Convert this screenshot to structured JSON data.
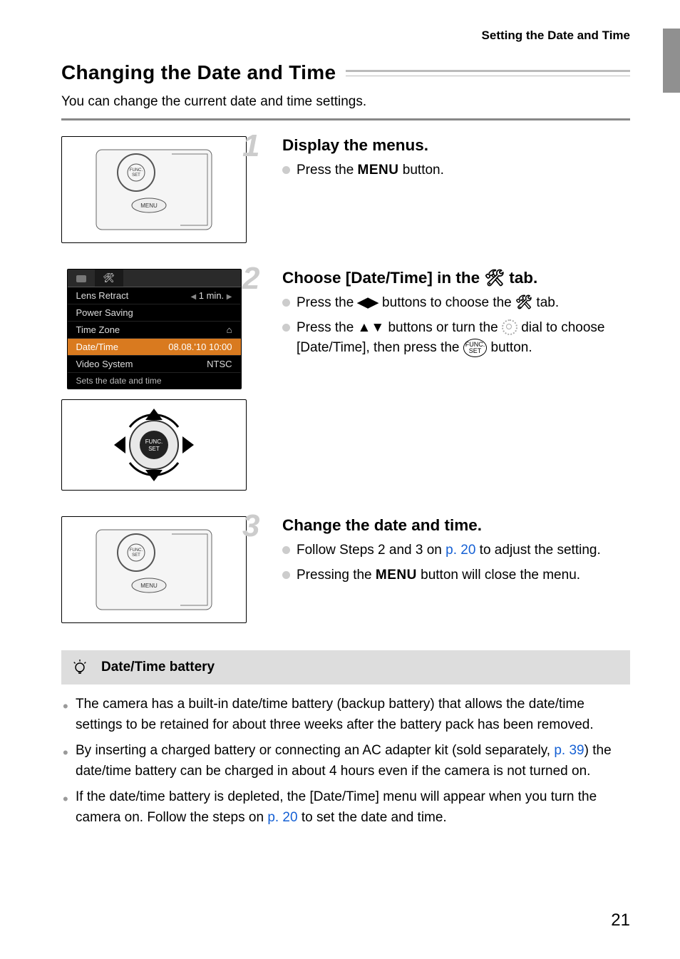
{
  "running_head": "Setting the Date and Time",
  "h1": "Changing the Date and Time",
  "lead": "You can change the current date and time settings.",
  "glyphs": {
    "menu": "MENU",
    "wrench": "🛠",
    "left_right": "◀▶",
    "up_down": "▲▼",
    "func_top": "FUNC.",
    "func_bot": "SET"
  },
  "steps": [
    {
      "num": "1",
      "title": "Display the menus.",
      "lines": {
        "a_pre": "Press the ",
        "a_post": " button."
      }
    },
    {
      "num": "2",
      "title_pre": "Choose [Date/Time] in the ",
      "title_post": " tab.",
      "lines": {
        "a_pre": "Press the ",
        "a_mid": " buttons to choose the ",
        "a_post": " tab.",
        "b_pre": "Press the ",
        "b_mid1": " buttons or turn the ",
        "b_mid2": " dial to choose [Date/Time], then press the ",
        "b_post": " button."
      },
      "menu": {
        "tab_wrench": "🛠",
        "rows": [
          {
            "label": "Lens Retract",
            "value": "1 min."
          },
          {
            "label": "Power Saving",
            "value": ""
          },
          {
            "label": "Time Zone",
            "value": "⌂"
          },
          {
            "label": "Date/Time",
            "value": "08.08.'10 10:00"
          },
          {
            "label": "Video System",
            "value": "NTSC"
          }
        ],
        "footer": "Sets the date and time"
      }
    },
    {
      "num": "3",
      "title": "Change the date and time.",
      "lines": {
        "a_pre": "Follow Steps 2 and 3 on ",
        "a_link": "p. 20",
        "a_post": " to adjust the setting.",
        "b_pre": "Pressing the ",
        "b_post": " button will close the menu."
      }
    }
  ],
  "tip": {
    "title": "Date/Time battery",
    "items": {
      "a": "The camera has a built-in date/time battery (backup battery) that allows the date/time settings to be retained for about three weeks after the battery pack has been removed.",
      "b_pre": "By inserting a charged battery or connecting an AC adapter kit (sold separately, ",
      "b_link": "p. 39",
      "b_post": ") the date/time battery can be charged in about 4 hours even if the camera is not turned on.",
      "c_pre": "If the date/time battery is depleted, the [Date/Time] menu will appear when you turn the camera on. Follow the steps on ",
      "c_link": "p. 20",
      "c_post": " to set the date and time."
    }
  },
  "page_number": "21"
}
